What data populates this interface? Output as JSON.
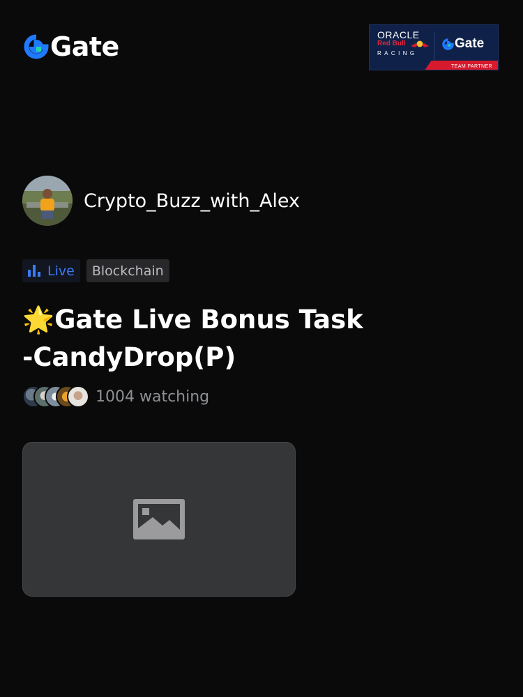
{
  "brand": {
    "name": "Gate",
    "accent": "#1f7aff",
    "accent_secondary": "#20d6a8"
  },
  "partner_banner": {
    "sponsor": "ORACLE",
    "team": "Red Bull",
    "racing": "RACING",
    "partner_brand": "Gate",
    "ribbon": "TEAM PARTNER"
  },
  "host": {
    "name": "Crypto_Buzz_with_Alex"
  },
  "tags": {
    "live_label": "Live",
    "category": "Blockchain",
    "live_color": "#3a7cf4"
  },
  "stream": {
    "title_emoji": "🌟",
    "title": "Gate Live Bonus Task -CandyDrop(P)",
    "watching_text": "1004 watching"
  },
  "viewer_avatars": [
    "viewer-avatar",
    "viewer-avatar",
    "viewer-avatar",
    "viewer-avatar",
    "viewer-avatar"
  ],
  "thumbnail": {
    "icon": "image-placeholder-icon"
  }
}
